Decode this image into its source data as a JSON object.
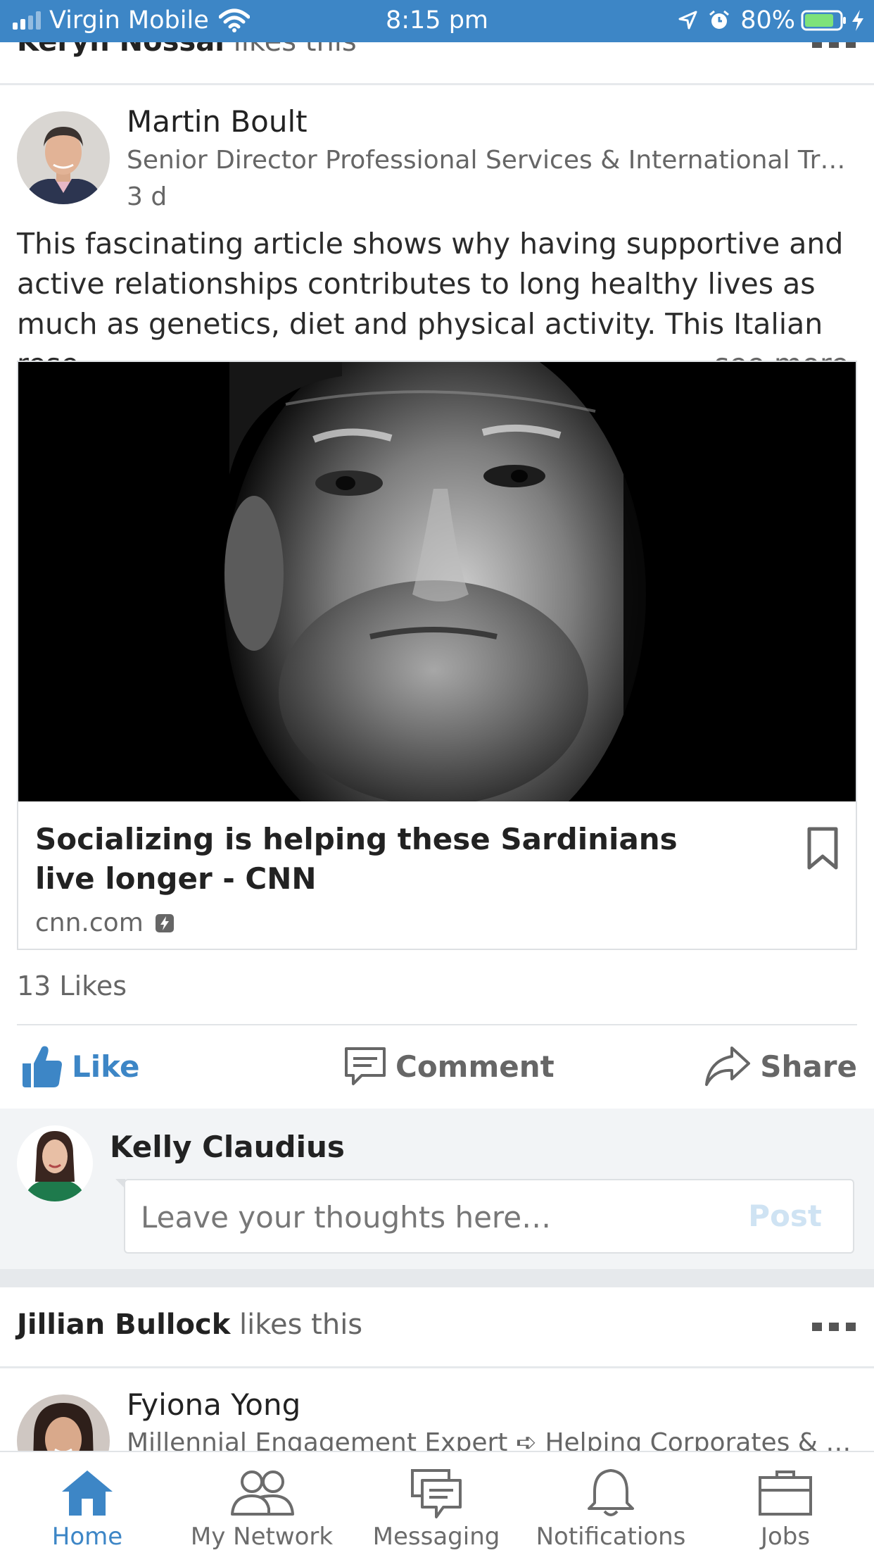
{
  "status_bar": {
    "carrier": "Virgin Mobile",
    "time": "8:15 pm",
    "battery": "80%"
  },
  "previous_post": {
    "liker_name": "Keryn Nossal",
    "liker_action": "likes this"
  },
  "post": {
    "author_name": "Martin Boult",
    "author_headline": "Senior Director Professional Services & International Training…",
    "time_ago": "3 d",
    "text": "This fascinating article shows why having supportive and active relationships contributes to long healthy lives as much as genetics, diet and physical activity. This Italian rese",
    "see_more": "…see more",
    "article": {
      "title": "Socializing is helping these Sardinians live longer - CNN",
      "source": "cnn.com"
    },
    "likes_count": "13 Likes",
    "actions": {
      "like": "Like",
      "comment": "Comment",
      "share": "Share"
    },
    "comment_composer": {
      "user_name": "Kelly Claudius",
      "placeholder": "Leave your thoughts here…",
      "post_label": "Post"
    }
  },
  "next_post": {
    "liker_name": "Jillian Bullock",
    "liker_action": "likes this",
    "author_name": "Fyiona Yong",
    "author_headline": "Millennial Engagement Expert ➪ Helping Corporates & Execut…"
  },
  "tab_bar": {
    "tabs": [
      {
        "label": "Home",
        "icon": "home-icon",
        "active": true
      },
      {
        "label": "My Network",
        "icon": "network-icon"
      },
      {
        "label": "Messaging",
        "icon": "messaging-icon"
      },
      {
        "label": "Notifications",
        "icon": "bell-icon"
      },
      {
        "label": "Jobs",
        "icon": "briefcase-icon"
      }
    ]
  },
  "colors": {
    "accent": "#3d86c6",
    "status_bar": "#3d86c6",
    "text_secondary": "#666666",
    "post_button_disabled": "#cfe3f3"
  }
}
